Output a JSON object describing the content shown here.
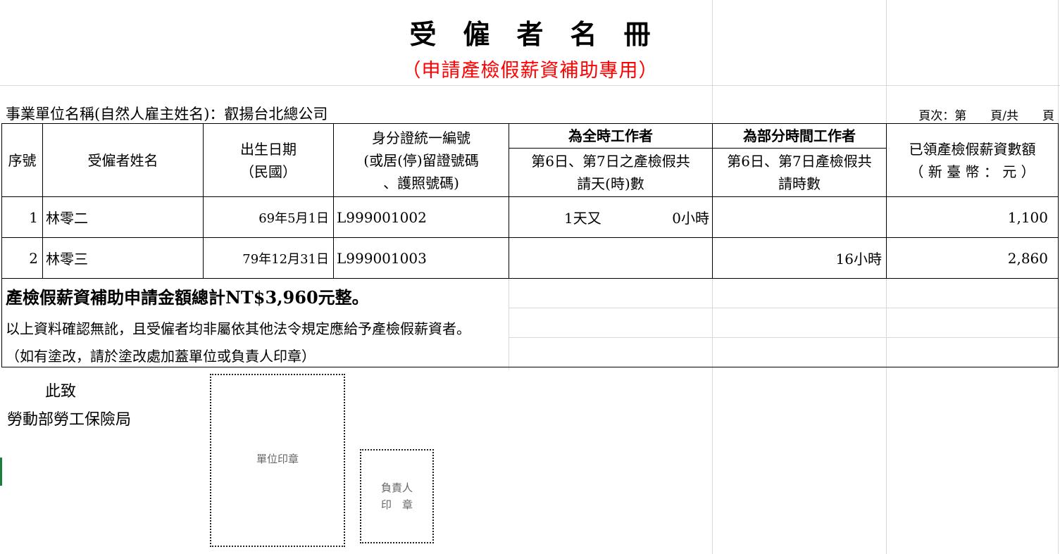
{
  "document": {
    "title": "受僱者名冊",
    "subtitle": "（申請產檢假薪資補助專用）",
    "company_label": "事業單位名稱(自然人雇主姓名)：",
    "company_name": "叡揚台北總公司",
    "pager": "頁次：第　　頁/共　　頁"
  },
  "table": {
    "headers": {
      "seq": "序號",
      "name": "受僱者姓名",
      "birth_line1": "出生日期",
      "birth_line2": "（民國）",
      "id_line1": "身分證統一編號",
      "id_line2": "(或居(停)留證號碼",
      "id_line3": "、護照號碼)",
      "fulltime_group": "為全時工作者",
      "fulltime_line1": "第6日、第7日之產檢假共",
      "fulltime_line2": "請天(時)數",
      "parttime_group": "為部分時間工作者",
      "parttime_line1": "第6日、第7日產檢假共",
      "parttime_line2": "請時數",
      "amount_line1": "已領產檢假薪資數額",
      "amount_line2": "（ 新 臺 幣 ： 元 ）"
    },
    "rows": [
      {
        "seq": "1",
        "name": "林零二",
        "birth": "69年5月1日",
        "id": "L999001002",
        "fulltime_days": "1天又",
        "fulltime_hours": "0小時",
        "parttime_hours": "",
        "amount": "1,100"
      },
      {
        "seq": "2",
        "name": "林零三",
        "birth": "79年12月31日",
        "id": "L999001003",
        "fulltime_days": "",
        "fulltime_hours": "",
        "parttime_hours": "16小時",
        "amount": "2,860"
      }
    ]
  },
  "total": "產檢假薪資補助申請金額總計NT$3,960元整。",
  "confirm": "以上資料確認無訛，且受僱者均非屬依其他法令規定應給予產檢假薪資者。",
  "note": "（如有塗改，請於塗改處加蓋單位或負責人印章）",
  "salutation": "此致",
  "agency": "勞動部勞工保險局",
  "stamps": {
    "unit": "單位印章",
    "rep_line1": "負責人",
    "rep_line2": "印　章"
  }
}
